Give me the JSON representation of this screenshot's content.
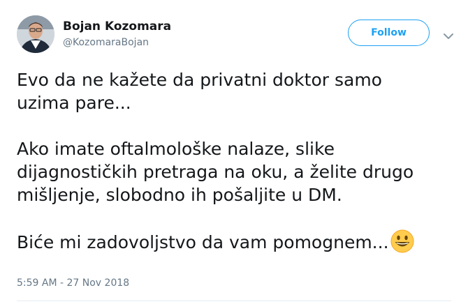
{
  "author": {
    "display_name": "Bojan Kozomara",
    "handle": "@KozomaraBojan"
  },
  "follow_button": {
    "label": "Follow"
  },
  "tweet": {
    "paragraphs": [
      [
        "Evo da ne kažete da privatni doktor samo",
        "uzima pare..."
      ],
      [
        "Ako imate oftalmološke nalaze, slike",
        "dijagnostičkih pretraga na oku, a želite drugo",
        "mišljenje, slobodno ih pošaljite u DM."
      ],
      [
        "Biće mi zadovoljstvo da vam pomognem..."
      ]
    ],
    "emoji": "grinning-face-emoji",
    "timestamp": "5:59 AM - 27 Nov 2018"
  },
  "colors": {
    "accent": "#1da1f2",
    "text": "#14171a",
    "secondary": "#657786",
    "emoji_fill": "#ffcc4d"
  },
  "icons": {
    "menu": "chevron-down-icon"
  }
}
